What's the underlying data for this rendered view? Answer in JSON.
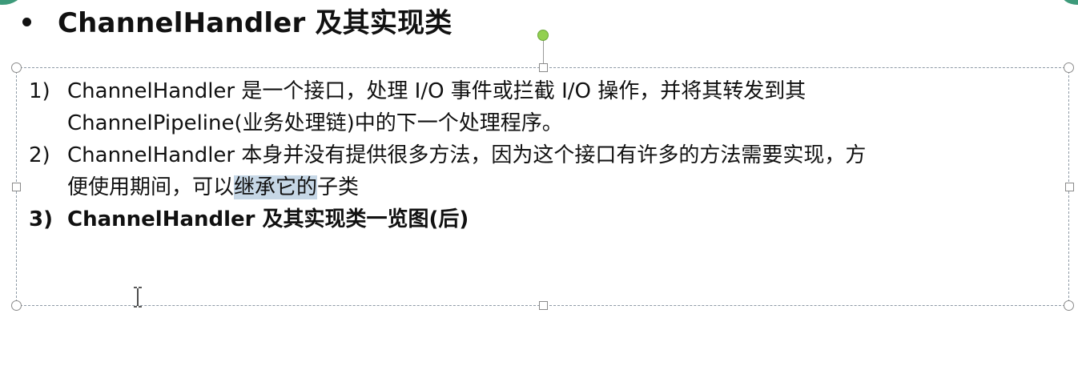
{
  "slide": {
    "title": "ChannelHandler 及其实现类",
    "items": [
      {
        "num": "1)",
        "line1": "ChannelHandler 是一个接口，处理 I/O 事件或拦截 I/O 操作，并将其转发到其",
        "line2": "ChannelPipeline(业务处理链)中的下一个处理程序。"
      },
      {
        "num": "2)",
        "line1": "ChannelHandler 本身并没有提供很多方法，因为这个接口有许多的方法需要实现，方",
        "line2_before": "便使用期间，可以",
        "line2_selected": "继承它的",
        "line2_after": "子类"
      },
      {
        "num": "3)",
        "line1": "ChannelHandler 及其实现类一览图(后)"
      }
    ]
  },
  "colors": {
    "accent_green": "#3d9a7a",
    "rotate_handle": "#92d050",
    "selection": "#c6d7e6",
    "border": "#8e9aa6"
  },
  "icons": {
    "title_bullet": "bullet-dot-icon",
    "cursor": "text-cursor-ibeam-icon",
    "rotate": "rotate-handle-icon"
  }
}
